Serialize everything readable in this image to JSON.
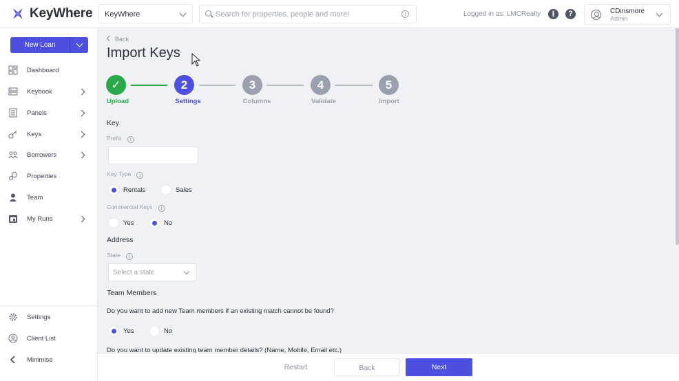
{
  "app": {
    "name": "KeyWhere",
    "brand_color": "#4d4fe0"
  },
  "header": {
    "workspace": "KeyWhere",
    "search_placeholder": "Search for properties, people and more!",
    "logged_in": "Logged in as: LMCRealty",
    "user_name": "CDinsmore",
    "user_role": "Admin"
  },
  "sidebar": {
    "new_loan": "New Loan",
    "items": [
      {
        "label": "Dashboard",
        "icon": "dashboard-icon",
        "expandable": false
      },
      {
        "label": "Keybook",
        "icon": "keybook-icon",
        "expandable": true
      },
      {
        "label": "Panels",
        "icon": "panels-icon",
        "expandable": true
      },
      {
        "label": "Keys",
        "icon": "key-icon",
        "expandable": true
      },
      {
        "label": "Borrowers",
        "icon": "borrowers-icon",
        "expandable": true
      },
      {
        "label": "Properties",
        "icon": "properties-icon",
        "expandable": false
      },
      {
        "label": "Team",
        "icon": "team-icon",
        "expandable": false
      },
      {
        "label": "My Runs",
        "icon": "calendar-icon",
        "expandable": true
      }
    ],
    "bottom": [
      {
        "label": "Settings",
        "icon": "gear-icon"
      },
      {
        "label": "Client List",
        "icon": "client-list-icon"
      },
      {
        "label": "Minimise",
        "icon": "chevron-left-icon"
      }
    ]
  },
  "page": {
    "back": "Back",
    "title": "Import Keys",
    "steps": [
      {
        "num": "✓",
        "label": "Upload",
        "state": "done"
      },
      {
        "num": "2",
        "label": "Settings",
        "state": "active"
      },
      {
        "num": "3",
        "label": "Columns",
        "state": "pending"
      },
      {
        "num": "4",
        "label": "Validate",
        "state": "pending"
      },
      {
        "num": "5",
        "label": "Import",
        "state": "pending"
      }
    ],
    "colors": {
      "done": "#2aa84a",
      "active": "#4d4fe0",
      "pending": "#9aa0ae"
    },
    "key_section": "Key",
    "prefix_label": "Prefix",
    "prefix_value": "",
    "key_type_label": "Key Type",
    "key_type_options": [
      "Rentals",
      "Sales"
    ],
    "key_type_selected": "Rentals",
    "commercial_label": "Commercial Keys",
    "commercial_options": [
      "Yes",
      "No"
    ],
    "commercial_selected": "No",
    "address_section": "Address",
    "state_label": "State",
    "state_placeholder": "Select a state",
    "team_section": "Team Members",
    "q1": "Do you want to add new Team members if an existing match cannot be found?",
    "q1_options": [
      "Yes",
      "No"
    ],
    "q1_selected": "Yes",
    "q2": "Do you want to update existing team member details? (Name, Mobile, Email etc.)"
  },
  "footer": {
    "restart": "Restart",
    "back": "Back",
    "next": "Next"
  }
}
